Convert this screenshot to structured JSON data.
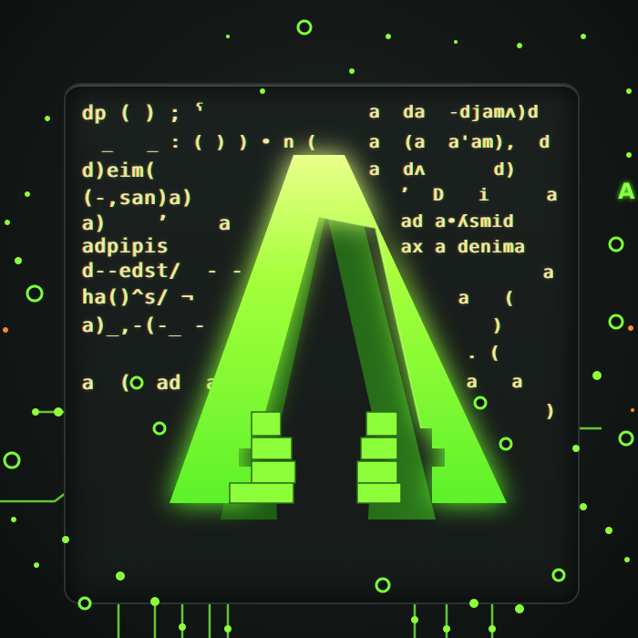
{
  "code_left": [
    "dp ( ) ; ˁ",
    "_   _ : ( ) ) • n (",
    "d)eim(",
    "(-,san)a)",
    "a)    ʼ    a",
    "adpipis",
    "d--edst/  - -",
    "ha()^s/ ¬",
    "a)_,-(-_ -",
    "a  (  ad  a"
  ],
  "code_right": [
    "a  da  -djamʌ)d",
    "a  (a  a'am),  d",
    "a  dʌ      d)",
    "ʼ  D   i     a",
    "ad a•ʎsmid",
    "ax a denima",
    "a",
    "a   (",
    ")",
    ". (",
    "a   a",
    ")"
  ],
  "side_letter": "A",
  "colors": {
    "accent": "#8cff3a",
    "accent_dim": "#5fd62a",
    "background": "#141917",
    "panel": "#1a201d",
    "code_text": "#f3e8b8"
  },
  "logo": {
    "glyph_icon": "letter-a-logo-icon"
  }
}
